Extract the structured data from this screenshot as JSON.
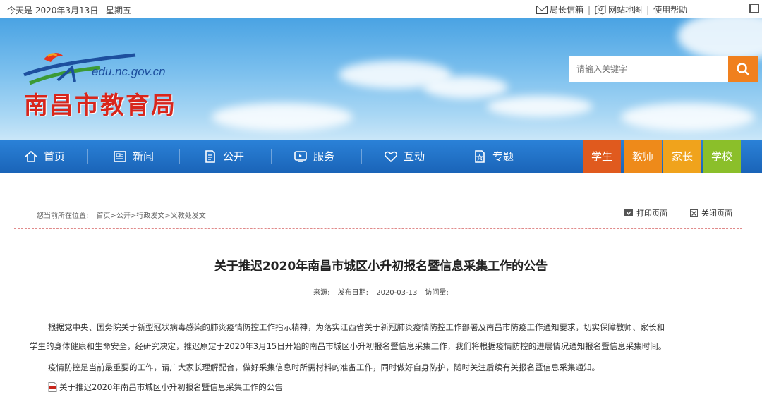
{
  "topbar": {
    "date": "今天是 2020年3月13日",
    "weekday": "星期五",
    "links": [
      "局长信箱",
      "网站地图",
      "使用帮助"
    ]
  },
  "banner": {
    "url": "edu.nc.gov.cn",
    "name": "南昌市教育局",
    "search_placeholder": "请输入关键字"
  },
  "nav": {
    "items": [
      "首页",
      "新闻",
      "公开",
      "服务",
      "互动",
      "专题"
    ],
    "roles": [
      "学生",
      "教师",
      "家长",
      "学校"
    ],
    "role_colors": [
      "#e05a1e",
      "#ee8a1a",
      "#f0a31c",
      "#8bbf2a"
    ]
  },
  "page": {
    "crumb_label": "您当前所在位置:",
    "crumb_path": "首页>公开>行政发文>义教处发文",
    "print_label": "打印页面",
    "close_label": "关闭页面",
    "title": "关于推迟2020年南昌市城区小升初报名暨信息采集工作的公告",
    "source_label": "来源:",
    "date_label": "发布日期:",
    "date_value": "2020-03-13",
    "visits_label": "访问量:",
    "para1_line1": "根据党中央、国务院关于新型冠状病毒感染的肺炎疫情防控工作指示精神，为落实江西省关于新冠肺炎疫情防控工作部署及南昌市防疫工作通知要求，切实保障教师、家长和",
    "para1_line2": "学生的身体健康和生命安全，经研究决定，推迟原定于2020年3月15日开始的南昌市城区小升初报名暨信息采集工作，我们将根据疫情防控的进展情况通知报名暨信息采集时间。",
    "para2": "疫情防控是当前最重要的工作，请广大家长理解配合，做好采集信息时所需材料的准备工作，同时做好自身防护，随时关注后续有关报名暨信息采集通知。",
    "attachment": "关于推迟2020年南昌市城区小升初报名暨信息采集工作的公告"
  }
}
